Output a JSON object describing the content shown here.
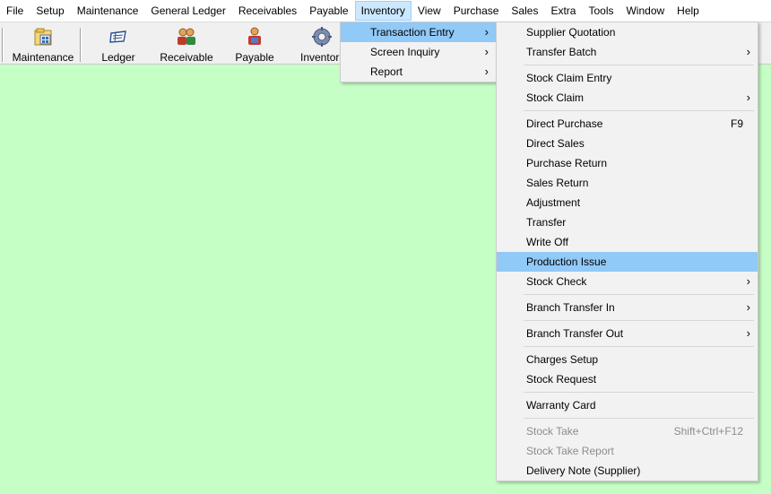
{
  "menubar": {
    "items": [
      "File",
      "Setup",
      "Maintenance",
      "General Ledger",
      "Receivables",
      "Payable",
      "Inventory",
      "View",
      "Purchase",
      "Sales",
      "Extra",
      "Tools",
      "Window",
      "Help"
    ]
  },
  "toolbar": {
    "buttons": [
      {
        "label": "Maintenance",
        "icon": "maintenance-icon"
      },
      {
        "label": "Ledger",
        "icon": "ledger-icon"
      },
      {
        "label": "Receivable",
        "icon": "receivable-icon"
      },
      {
        "label": "Payable",
        "icon": "payable-icon"
      },
      {
        "label": "Inventor",
        "icon": "inventory-gear-icon"
      }
    ]
  },
  "inventory_menu": {
    "items": [
      {
        "label": "Transaction Entry",
        "submenu": true,
        "highlighted": true
      },
      {
        "label": "Screen Inquiry",
        "submenu": true
      },
      {
        "label": "Report",
        "submenu": true
      }
    ]
  },
  "transaction_menu": {
    "groups": [
      [
        {
          "label": "Supplier Quotation"
        },
        {
          "label": "Transfer Batch",
          "submenu": true
        }
      ],
      [
        {
          "label": "Stock Claim Entry"
        },
        {
          "label": "Stock Claim",
          "submenu": true
        }
      ],
      [
        {
          "label": "Direct Purchase",
          "shortcut": "F9"
        },
        {
          "label": "Direct Sales"
        },
        {
          "label": "Purchase Return"
        },
        {
          "label": "Sales Return"
        },
        {
          "label": "Adjustment"
        },
        {
          "label": "Transfer"
        },
        {
          "label": "Write Off"
        },
        {
          "label": "Production Issue",
          "highlighted": true
        },
        {
          "label": "Stock Check",
          "submenu": true
        }
      ],
      [
        {
          "label": "Branch Transfer In",
          "submenu": true
        }
      ],
      [
        {
          "label": "Branch Transfer Out",
          "submenu": true
        }
      ],
      [
        {
          "label": "Charges Setup"
        },
        {
          "label": "Stock Request"
        }
      ],
      [
        {
          "label": "Warranty Card"
        }
      ],
      [
        {
          "label": "Stock Take",
          "shortcut": "Shift+Ctrl+F12",
          "disabled": true
        },
        {
          "label": "Stock Take Report",
          "disabled": true
        },
        {
          "label": "Delivery Note (Supplier)"
        }
      ]
    ]
  },
  "colors": {
    "workspace": "#c6ffc6",
    "highlight": "#91c9f7",
    "menubar_active": "#cce8ff"
  }
}
